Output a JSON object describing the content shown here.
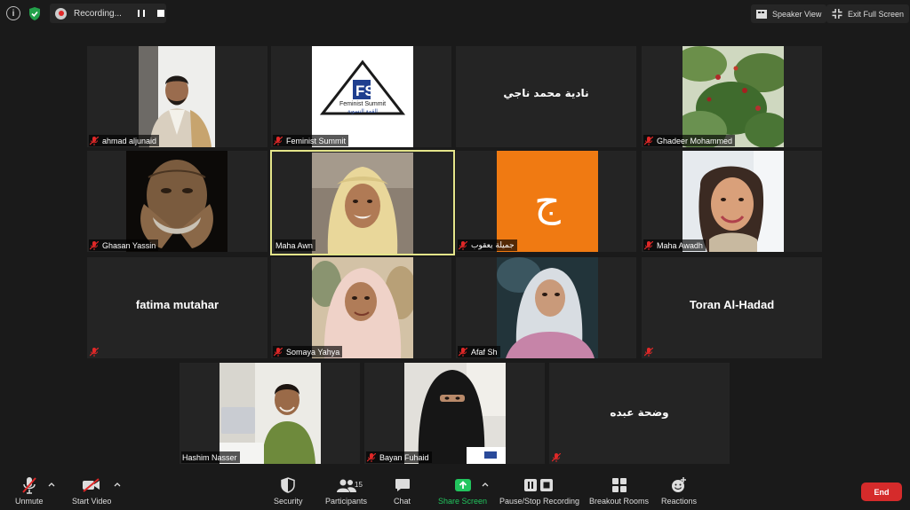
{
  "topbar": {
    "recording_label": "Recording...",
    "speaker_view_label": "Speaker View",
    "exit_fullscreen_label": "Exit Full Screen"
  },
  "tiles": [
    {
      "name": "ahmad aljunaid"
    },
    {
      "name": "Feminist Summit",
      "logo_text_en": "Feminist Summit",
      "logo_text_ar": "القمة النسوية"
    },
    {
      "name": "",
      "display": "نادية محمد ناجي"
    },
    {
      "name": "Ghadeer Mohammed"
    },
    {
      "name": "Ghasan Yassin"
    },
    {
      "name": "Maha Awn"
    },
    {
      "name": "جميلة يعقوب",
      "avatar_letter": "ج"
    },
    {
      "name": "Maha Awadh"
    },
    {
      "name": "",
      "display": "fatima mutahar"
    },
    {
      "name": "Somaya Yahya"
    },
    {
      "name": "Afaf Sh"
    },
    {
      "name": "",
      "display": "Toran Al-Hadad"
    },
    {
      "name": "Hashim Nasser"
    },
    {
      "name": "Bayan Fuhaid"
    },
    {
      "name": "",
      "display": "وضحة عبده"
    }
  ],
  "toolbar": {
    "unmute_label": "Unmute",
    "start_video_label": "Start Video",
    "security_label": "Security",
    "participants_label": "Participants",
    "participants_count": "15",
    "chat_label": "Chat",
    "share_screen_label": "Share Screen",
    "recording_control_label": "Pause/Stop Recording",
    "breakout_rooms_label": "Breakout Rooms",
    "reactions_label": "Reactions",
    "end_label": "End"
  },
  "colors": {
    "background": "#1a1a1a",
    "tile": "#242424",
    "active_speaker_border": "#e4e58a",
    "share_green": "#22c55e",
    "end_red": "#d52b2b",
    "avatar_orange": "#f07a12"
  }
}
